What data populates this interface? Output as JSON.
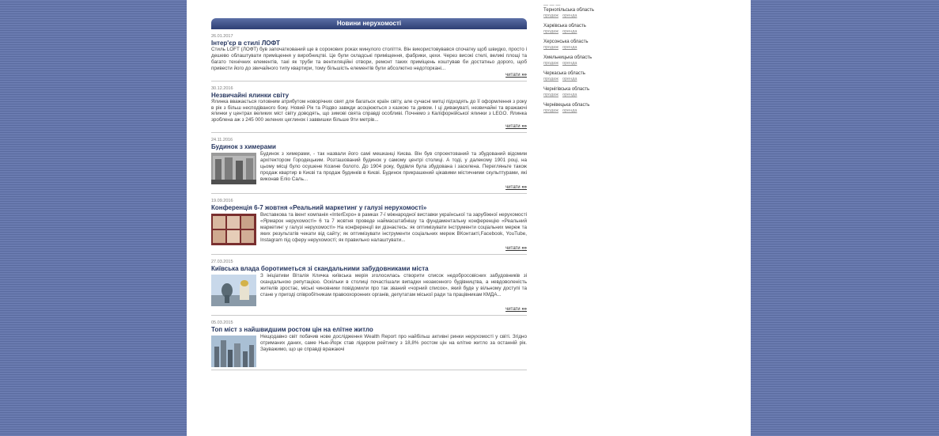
{
  "colors": {
    "header_blue": "#2d3f74",
    "title": "#26365f",
    "side_bg": "#6677aa"
  },
  "section_title": "Новини нерухомості",
  "read_more": "читати",
  "read_more_arrows": "»»",
  "news": [
    {
      "date": "26.01.2017",
      "title": "Інтер'єр в стилі ЛОФТ",
      "text": "Стиль LOFT (ЛОФТ) був започаткований ще в сорокових роках минулого століття. Він використовувався спочатку щоб швидко, просто і дешево облаштувати приміщення у виробництві. Це були складські приміщення, фабрики, цехи. Через високі стелі, великі площі та багато технічних елементів, такі як труби та вентиляційні отвори, ремонт таких приміщень коштував би достатньо дорого, щоб привести його до звичайного типу квартири, тому більшість елементів були абсолютно недоторкані..."
    },
    {
      "date": "30.12.2016",
      "title": "Незвичайні ялинки світу",
      "text": "Ялинка вважається головним атрибутом новорічних свят для багатьох країн світу, але сучасні митці підходять до її оформлення з року в рік з більш несподіваного боку. Новий Рік та Різдво завжди асоціюються з казкою та дивом. І ці дивакуваті, незвичайні та вражаючі ялинки у центрах великих міст світу доводять, що зимові свята справді особливі. Почнемо з Каліфорнійської ялинки з LEGO. Ялинка зроблена аж з 245 000 зелених цеглинок і заввишки більше 9ти метрів..."
    },
    {
      "date": "24.11.2016",
      "title": "Будинок з химерами",
      "text": "Будинок з химерами, - так назвали його самі мешканці Києва. Він був спроектований та збудований відомим архітектором Городецьким. Розташований будинок у самому центрі столиці. А тоді, у далекому 1901 році, на цьому місці було осушене Козине болото. До 1904 року, будівля була збудована і заселена. Перегляньте також продаж квартир в Києві та продаж будинків в Києві. Будинок прикрашений цікавими містичними скульптурами, які виконав Еліо Саль..."
    },
    {
      "date": "19.09.2016",
      "title": "Конференція 6-7 жовтня «Реальний маркетинг у галузі нерухомості»",
      "text": "Виставкова та івент компанія «InterExpo» в рамках 7-ї міжнародної виставки української та зарубіжної нерухомості «Ярмарок нерухомості» 6 та 7 жовтня проведе наймасштабнішу та фундаментальну конференцію «Реальний маркетинг у галузі нерухомості» На конференції ви дізнаєтесь: як оптимізувати інструменти соціальних мереж та яких результатів чекати від сайту; як оптимізувати інструменти соціальних мереж ВКонтакті,Facebook, YouTube, Instagram під сферу нерухомості; як правильно налаштувати..."
    },
    {
      "date": "27.03.2015",
      "title": "Київська влада боротиметься зі скандальними забудовниками міста",
      "text": "З ініціативи Віталія Кличка київська мерія зголосилась створити список недобросовісних забудовників зі скандальною репутацією. Оскільки в столиці почастішали випадки незаконного будівництва, а невдоволеність жителів зростає, міські чиновники повідомили про так званий «чорний список», який буде у вільному доступі та стане у пригоді співробітникам правоохоронних органів, депутатам міської ради та працівникам КМДА..."
    },
    {
      "date": "05.03.2015",
      "title": "Топ міст з найшвидшим ростом цін на елітне житло",
      "text": "Нещодавно світ побачив нове дослідження Wealth Report про найбільш активні ринки нерухомості у світі. Згідно отриманих даних, саме Нью-Йорк став лідером рейтингу з 18,8% ростом цін на елітне житло за останній рік. Зауважимо, що це справді вражаючі"
    }
  ],
  "regions": [
    {
      "name": "Тернопільська область"
    },
    {
      "name": "Харківська область"
    },
    {
      "name": "Херсонська область"
    },
    {
      "name": "Хмельницька область"
    },
    {
      "name": "Черкаська область"
    },
    {
      "name": "Чернігівська область"
    },
    {
      "name": "Чернівецька область"
    }
  ],
  "region_links": {
    "sale": "продаж",
    "rent": "оренда"
  },
  "top_stub": "— — —"
}
